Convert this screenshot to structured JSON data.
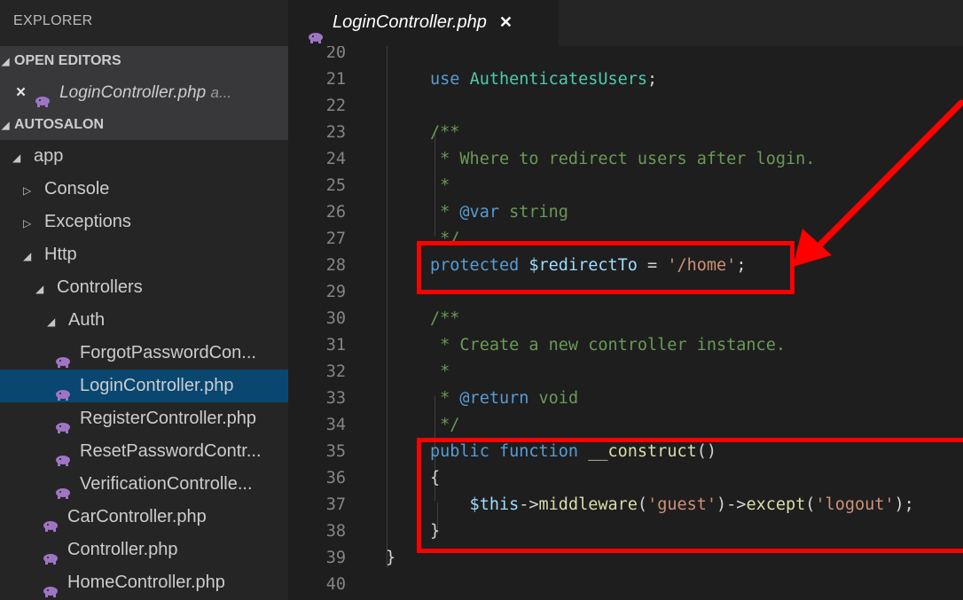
{
  "sidebar": {
    "title": "EXPLORER",
    "open_editors": {
      "header": "OPEN EDITORS",
      "items": [
        {
          "close": "×",
          "name": "LoginController.php",
          "dir": "a..."
        }
      ]
    },
    "project": {
      "header": "AUTOSALON",
      "tree": [
        {
          "label": "app",
          "twisty": "◢"
        },
        {
          "label": "Console",
          "twisty": "▷"
        },
        {
          "label": "Exceptions",
          "twisty": "▷"
        },
        {
          "label": "Http",
          "twisty": "◢"
        },
        {
          "label": "Controllers",
          "twisty": "◢"
        },
        {
          "label": "Auth",
          "twisty": "◢"
        },
        {
          "label": "ForgotPasswordCon..."
        },
        {
          "label": "LoginController.php"
        },
        {
          "label": "RegisterController.php"
        },
        {
          "label": "ResetPasswordContr..."
        },
        {
          "label": "VerificationControlle..."
        },
        {
          "label": "CarController.php"
        },
        {
          "label": "Controller.php"
        },
        {
          "label": "HomeController.php"
        }
      ]
    }
  },
  "editor": {
    "tab": {
      "name": "LoginController.php",
      "close": "✕"
    },
    "lines": [
      {
        "n": "20",
        "seg": []
      },
      {
        "n": "21",
        "seg": [
          [
            "kw",
            "use "
          ],
          [
            "cls",
            "AuthenticatesUsers"
          ],
          [
            "",
            ";"
          ]
        ]
      },
      {
        "n": "22",
        "seg": []
      },
      {
        "n": "23",
        "seg": [
          [
            "cmt",
            "/**"
          ]
        ]
      },
      {
        "n": "24",
        "seg": [
          [
            "cmt",
            " * Where to redirect users after login."
          ]
        ]
      },
      {
        "n": "25",
        "seg": [
          [
            "cmt",
            " *"
          ]
        ]
      },
      {
        "n": "26",
        "seg": [
          [
            "cmt",
            " * "
          ],
          [
            "doctag",
            "@var"
          ],
          [
            "cmt",
            " string"
          ]
        ]
      },
      {
        "n": "27",
        "seg": [
          [
            "cmt",
            " */"
          ]
        ]
      },
      {
        "n": "28",
        "seg": [
          [
            "kw",
            "protected "
          ],
          [
            "var",
            "$redirectTo"
          ],
          [
            "",
            " = "
          ],
          [
            "str",
            "'/home'"
          ],
          [
            "",
            ";"
          ]
        ]
      },
      {
        "n": "29",
        "seg": []
      },
      {
        "n": "30",
        "seg": [
          [
            "cmt",
            "/**"
          ]
        ]
      },
      {
        "n": "31",
        "seg": [
          [
            "cmt",
            " * Create a new controller instance."
          ]
        ]
      },
      {
        "n": "32",
        "seg": [
          [
            "cmt",
            " *"
          ]
        ]
      },
      {
        "n": "33",
        "seg": [
          [
            "cmt",
            " * "
          ],
          [
            "doctag",
            "@return"
          ],
          [
            "cmt",
            " void"
          ]
        ]
      },
      {
        "n": "34",
        "seg": [
          [
            "cmt",
            " */"
          ]
        ]
      },
      {
        "n": "35",
        "seg": [
          [
            "kw",
            "public function "
          ],
          [
            "fn",
            "__construct"
          ],
          [
            "",
            "()"
          ]
        ]
      },
      {
        "n": "36",
        "seg": [
          [
            "",
            "{"
          ]
        ]
      },
      {
        "n": "37",
        "seg": [
          [
            "var",
            "    $this"
          ],
          [
            "",
            "->"
          ],
          [
            "fn",
            "middleware"
          ],
          [
            "",
            "("
          ],
          [
            "str",
            "'guest'"
          ],
          [
            "",
            ")->"
          ],
          [
            "fn",
            "except"
          ],
          [
            "",
            "("
          ],
          [
            "str",
            "'logout'"
          ],
          [
            "",
            ");"
          ]
        ]
      },
      {
        "n": "38",
        "seg": [
          [
            "",
            "}"
          ]
        ]
      },
      {
        "n": "39",
        "seg": [
          [
            "",
            "}"
          ]
        ]
      },
      {
        "n": "40",
        "seg": []
      }
    ]
  },
  "colors": {
    "annotation": "#ff0000",
    "php_icon": "#a074c4",
    "selection": "#094771"
  }
}
